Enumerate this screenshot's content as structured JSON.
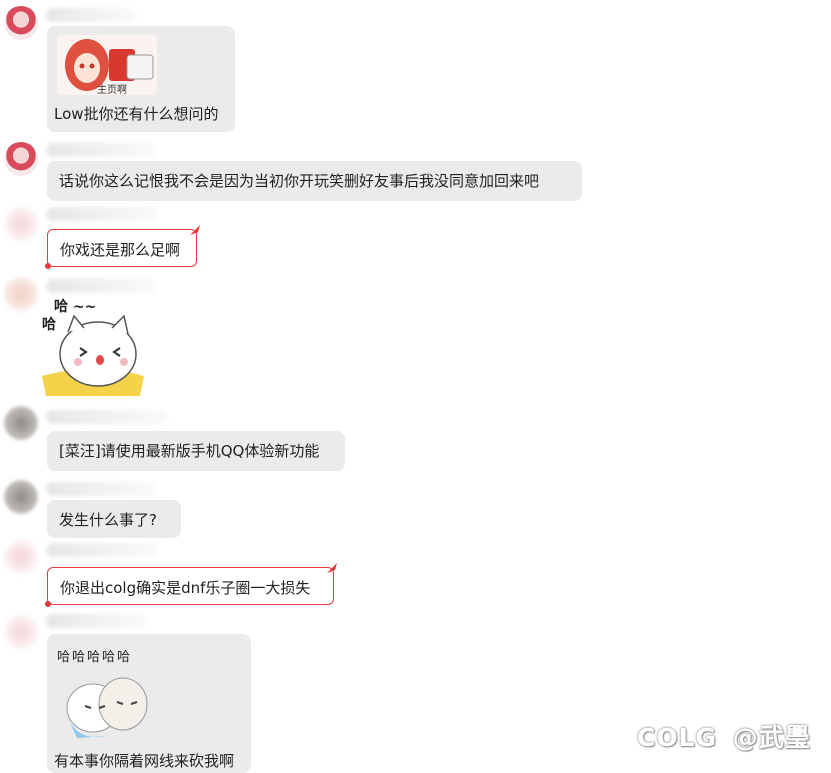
{
  "messages": [
    {
      "caption": "Low批你还有什么想问的",
      "sticker_caption": "主页啊"
    },
    {
      "text": "话说你这么记恨我不会是因为当初你开玩笑删好友事后我没同意加回来吧"
    },
    {
      "text": "你戏还是那么足啊"
    },
    {
      "sticker_text_top": "哈 ~~",
      "sticker_text_left": "哈"
    },
    {
      "text": "[菜汪]请使用最新版手机QQ体验新功能"
    },
    {
      "text": "发生什么事了?"
    },
    {
      "text": "你退出colg确实是dnf乐子圈一大损失"
    },
    {
      "caption": "有本事你隔着网线来砍我啊",
      "sticker_text": "哈哈哈哈哈"
    }
  ],
  "watermark": {
    "logo": "COLG",
    "handle": "@武璺"
  },
  "colors": {
    "bubble": "#ebebeb",
    "vip_border": "#e23a3a"
  }
}
